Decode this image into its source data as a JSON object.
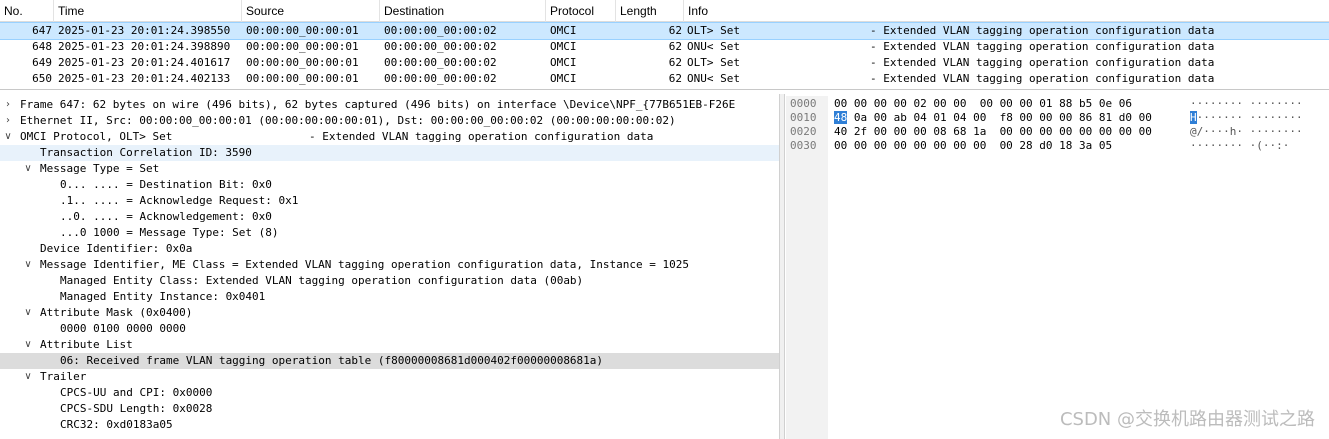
{
  "packet_list": {
    "columns": [
      "No.",
      "Time",
      "Source",
      "Destination",
      "Protocol",
      "Length",
      "Info"
    ],
    "rows": [
      {
        "no": "647",
        "time": "2025-01-23 20:01:24.398550",
        "src": "00:00:00_00:00:01",
        "dst": "00:00:00_00:00:02",
        "proto": "OMCI",
        "len": "62",
        "info": "OLT> Set",
        "info2": "- Extended VLAN tagging operation configuration data"
      },
      {
        "no": "648",
        "time": "2025-01-23 20:01:24.398890",
        "src": "00:00:00_00:00:01",
        "dst": "00:00:00_00:00:02",
        "proto": "OMCI",
        "len": "62",
        "info": "ONU< Set",
        "info2": "- Extended VLAN tagging operation configuration data"
      },
      {
        "no": "649",
        "time": "2025-01-23 20:01:24.401617",
        "src": "00:00:00_00:00:01",
        "dst": "00:00:00_00:00:02",
        "proto": "OMCI",
        "len": "62",
        "info": "OLT> Set",
        "info2": "- Extended VLAN tagging operation configuration data"
      },
      {
        "no": "650",
        "time": "2025-01-23 20:01:24.402133",
        "src": "00:00:00_00:00:01",
        "dst": "00:00:00_00:00:02",
        "proto": "OMCI",
        "len": "62",
        "info": "ONU< Set",
        "info2": "- Extended VLAN tagging operation configuration data"
      }
    ]
  },
  "details": {
    "lines": [
      {
        "text": "Frame 647: 62 bytes on wire (496 bits), 62 bytes captured (496 bits) on interface \\Device\\NPF_{77B651EB-F26E",
        "twisty": "collapsed"
      },
      {
        "text": "Ethernet II, Src: 00:00:00_00:00:01 (00:00:00:00:00:01), Dst: 00:00:00_00:00:02 (00:00:00:00:00:02)",
        "twisty": "collapsed"
      },
      {
        "text": "OMCI Protocol, OLT> Set",
        "text2": "- Extended VLAN tagging operation configuration data",
        "twisty": "expanded"
      },
      {
        "text": "Transaction Correlation ID: 3590",
        "twisty": "none"
      },
      {
        "text": "Message Type = Set",
        "twisty": "expanded"
      },
      {
        "text": "0... .... = Destination Bit: 0x0",
        "twisty": "none"
      },
      {
        "text": ".1.. .... = Acknowledge Request: 0x1",
        "twisty": "none"
      },
      {
        "text": "..0. .... = Acknowledgement: 0x0",
        "twisty": "none"
      },
      {
        "text": "...0 1000 = Message Type: Set (8)",
        "twisty": "none"
      },
      {
        "text": "Device Identifier: 0x0a",
        "twisty": "none"
      },
      {
        "text": "Message Identifier, ME Class = Extended VLAN tagging operation configuration data, Instance = 1025",
        "twisty": "expanded"
      },
      {
        "text": "Managed Entity Class: Extended VLAN tagging operation configuration data (00ab)",
        "twisty": "none"
      },
      {
        "text": "Managed Entity Instance: 0x0401",
        "twisty": "none"
      },
      {
        "text": "Attribute Mask (0x0400)",
        "twisty": "expanded"
      },
      {
        "text": "0000 0100 0000 0000",
        "twisty": "none"
      },
      {
        "text": "Attribute List",
        "twisty": "expanded"
      },
      {
        "text": "06: Received frame VLAN tagging operation table (f80000008681d000402f00000008681a)",
        "twisty": "none"
      },
      {
        "text": "Trailer",
        "twisty": "expanded"
      },
      {
        "text": "CPCS-UU and CPI: 0x0000",
        "twisty": "none"
      },
      {
        "text": "CPCS-SDU Length: 0x0028",
        "twisty": "none"
      },
      {
        "text": "CRC32: 0xd0183a05",
        "twisty": "none"
      }
    ]
  },
  "bytes": {
    "rows": [
      {
        "offset": "0000",
        "hex": "00 00 00 00 02 00 00  00 00 00 01 88 b5 0e 06",
        "ascii": "········ ········"
      },
      {
        "offset": "0010",
        "hex_sel": "48",
        "hex": " 0a 00 ab 04 01 04 00  f8 00 00 00 86 81 d0 00",
        "ascii_sel": "H",
        "ascii": "······· ········"
      },
      {
        "offset": "0020",
        "hex": "40 2f 00 00 00 08 68 1a  00 00 00 00 00 00 00 00",
        "ascii": "@/····h· ········"
      },
      {
        "offset": "0030",
        "hex": "00 00 00 00 00 00 00 00  00 28 d0 18 3a 05",
        "ascii": "········ ·(··:·"
      }
    ]
  },
  "watermark": "CSDN @交换机路由器测试之路"
}
